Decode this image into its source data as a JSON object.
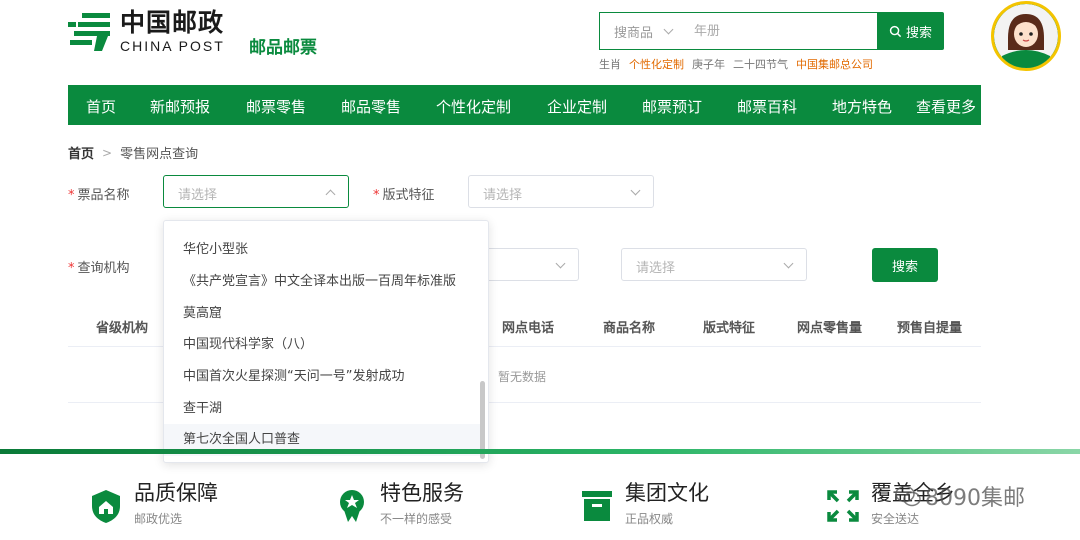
{
  "header": {
    "logo_cn": "中国邮政",
    "logo_en": "CHINA POST",
    "logo_sub": "邮品邮票",
    "search": {
      "category": "搜商品",
      "placeholder": "年册",
      "button": "搜索"
    },
    "hot_words": [
      {
        "text": "生肖",
        "highlight": false
      },
      {
        "text": "个性化定制",
        "highlight": true
      },
      {
        "text": "庚子年",
        "highlight": false
      },
      {
        "text": "二十四节气",
        "highlight": false
      },
      {
        "text": "中国集邮总公司",
        "highlight": true
      }
    ],
    "avatar_label": "中国邮政"
  },
  "nav": {
    "items": [
      "首页",
      "新邮预报",
      "邮票零售",
      "邮品零售",
      "个性化定制",
      "企业定制",
      "邮票预订",
      "邮票百科",
      "地方特色",
      "查看更多"
    ]
  },
  "breadcrumb": {
    "home": "首页",
    "current": "零售网点查询"
  },
  "form": {
    "ticket_name": {
      "label": "票品名称",
      "placeholder": "请选择"
    },
    "format_feature": {
      "label": "版式特征",
      "placeholder": "请选择"
    },
    "query_org": {
      "label": "查询机构",
      "placeholder_2": "请选择"
    },
    "search_button": "搜索"
  },
  "dropdown": {
    "items": [
      "华佗小型张",
      "《共产党宣言》中文全译本出版一百周年标准版",
      "莫高窟",
      "中国现代科学家（八）",
      "中国首次火星探测“天问一号”发射成功",
      "查干湖",
      "第七次全国人口普查"
    ]
  },
  "table": {
    "headers": [
      "省级机构",
      "网点电话",
      "商品名称",
      "版式特征",
      "网点零售量",
      "预售自提量"
    ],
    "empty_text": "暂无数据"
  },
  "footer": {
    "features": [
      {
        "title": "品质保障",
        "sub": "邮政优选"
      },
      {
        "title": "特色服务",
        "sub": "不一样的感受"
      },
      {
        "title": "集团文化",
        "sub": "正品权威"
      },
      {
        "title": "覆盖全乡",
        "sub": "安全送达"
      }
    ],
    "watermark": "8090集邮"
  },
  "colors": {
    "brand_green": "#0a8a3e",
    "highlight_orange": "#e26a00",
    "required_red": "#e33"
  }
}
